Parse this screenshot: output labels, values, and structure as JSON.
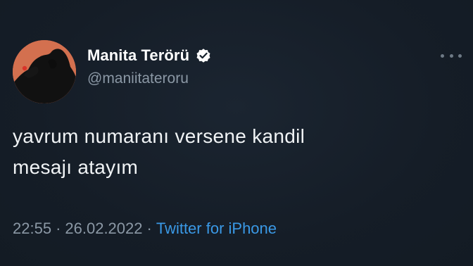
{
  "user": {
    "display_name": "Manita Terörü",
    "handle": "@maniitateroru",
    "verified": true
  },
  "tweet": {
    "text_line_1": "yavrum numaranı versene kandil",
    "text_line_2": "mesajı atayım"
  },
  "meta": {
    "time": "22:55",
    "separator": "·",
    "date": "26.02.2022",
    "source": "Twitter for iPhone"
  },
  "icons": {
    "verified": "verified-badge-icon",
    "more": "more-options-icon"
  },
  "colors": {
    "background": "#15202b",
    "accent": "#3a99e6",
    "secondary_text": "#8b98a5",
    "avatar_bg": "#d3704f"
  }
}
